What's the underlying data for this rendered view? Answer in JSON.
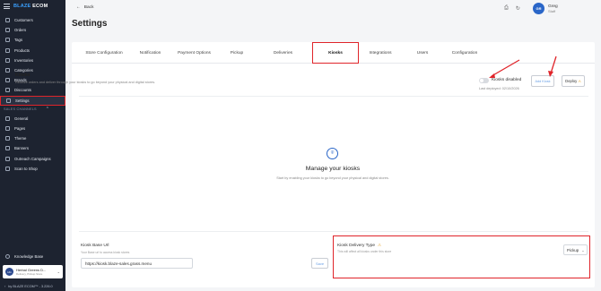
{
  "brand": {
    "prefix": "BLAZE",
    "name": "ECOM"
  },
  "sidebar": {
    "items": [
      {
        "label": "Customers",
        "icon": "user-icon"
      },
      {
        "label": "Orders",
        "icon": "cart-icon"
      },
      {
        "label": "Tags",
        "icon": "tag-icon"
      },
      {
        "label": "Products",
        "icon": "box-icon"
      },
      {
        "label": "Inventories",
        "icon": "inventory-icon"
      },
      {
        "label": "Categories",
        "icon": "category-icon"
      },
      {
        "label": "Brands",
        "icon": "brand-icon"
      },
      {
        "label": "Discounts",
        "icon": "discount-icon"
      },
      {
        "label": "Settings",
        "icon": "gear-icon"
      }
    ],
    "group_label": "SALES CHANNELS",
    "group_items": [
      {
        "label": "General",
        "icon": "settings-icon"
      },
      {
        "label": "Pages",
        "icon": "page-icon"
      },
      {
        "label": "Theme",
        "icon": "theme-icon"
      },
      {
        "label": "Banners",
        "icon": "banner-icon"
      },
      {
        "label": "Outreach Campaigns",
        "icon": "megaphone-icon"
      },
      {
        "label": "Scan to Shop",
        "icon": "qr-icon"
      }
    ],
    "knowledge_base": "Knowledge Base",
    "store": {
      "name": "Herbal Greens D...",
      "sub": "Delivery, Pickup Store"
    },
    "version": "by BLAZE ECOM™ - 3.226.0"
  },
  "header": {
    "back": "Back",
    "title": "Settings",
    "user": {
      "initials": "GR",
      "name": "Greg",
      "role": "Staff"
    }
  },
  "tabs": [
    "Store Configuration",
    "Notification",
    "Payment Options",
    "Pickup",
    "Deliveries",
    "Kiosks",
    "Integrations",
    "Users",
    "Configuration"
  ],
  "kiosks": {
    "title": "Kiosks",
    "description": "Receive orders and deliver through your kiosks to go beyond your physical and digital stores.",
    "toggle_label": "Kiosks disabled",
    "toggle_on": false,
    "last_deployed": "Last deployed: 02/10/2026",
    "add_kiosk": "Add Kiosk",
    "deploy": "Deploy",
    "empty_title": "Manage your kiosks",
    "empty_desc": "Start by enabling your kiosks to go beyond your physical and digital stores."
  },
  "base_url": {
    "label": "Kiosk Base Url",
    "hint": "Your Base url to access kiosk stores",
    "value": "https://kiosk.blaze-sales.grass.menu",
    "save": "Save"
  },
  "delivery": {
    "label": "Kiosk Delivery Type",
    "hint": "This will affect all kiosks under this store",
    "value": "Pickup"
  },
  "colors": {
    "accent": "#2a66c8",
    "highlight": "#e0242a",
    "sidebar": "#1d2330"
  }
}
